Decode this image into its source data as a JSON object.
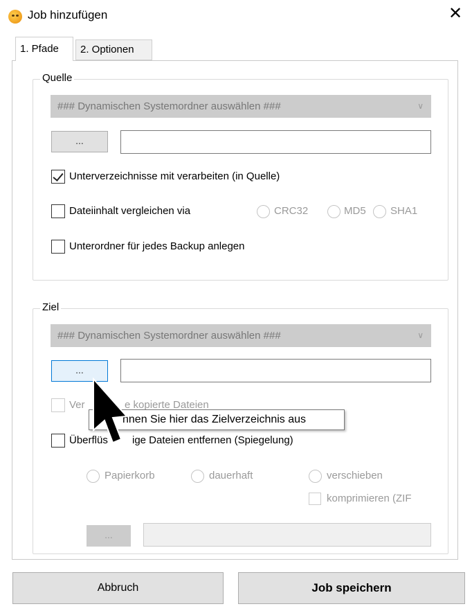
{
  "window": {
    "title": "Job hinzufügen",
    "icon": "smiley-app-icon",
    "close_glyph": "✕"
  },
  "tabs": [
    {
      "label": "1. Pfade",
      "active": true
    },
    {
      "label": "2. Optionen",
      "active": false
    }
  ],
  "source": {
    "group_label": "Quelle",
    "combo_value": "### Dynamischen Systemordner auswählen ###",
    "browse_label": "...",
    "path_value": "",
    "subdirs_label": "Unterverzeichnisse mit verarbeiten (in Quelle)",
    "subdirs_checked": true,
    "compare_label": "Dateiinhalt vergleichen via",
    "compare_checked": false,
    "hash_options": [
      "CRC32",
      "MD5",
      "SHA1"
    ],
    "subfolder_label": "Unterordner für jedes Backup anlegen",
    "subfolder_checked": false
  },
  "target": {
    "group_label": "Ziel",
    "combo_value": "### Dynamischen Systemordner auswählen ###",
    "browse_label": "...",
    "path_value": "",
    "verify_label_left": "Ver",
    "verify_label_right": "e kopierte Dateien",
    "mirror_label_left": "Überflüs",
    "mirror_label_right": "ige Dateien entfernen (Spiegelung)",
    "delete_options": [
      "Papierkorb",
      "dauerhaft",
      "verschieben"
    ],
    "compress_label": "komprimieren (ZIF",
    "move_browse_label": "...",
    "move_path_value": ""
  },
  "tooltip": {
    "text": "nnen Sie hier das Zielverzeichnis aus"
  },
  "buttons": {
    "cancel": "Abbruch",
    "save": "Job speichern"
  },
  "colors": {
    "focus_border": "#0078d7",
    "disabled_fill": "#cccccc"
  }
}
